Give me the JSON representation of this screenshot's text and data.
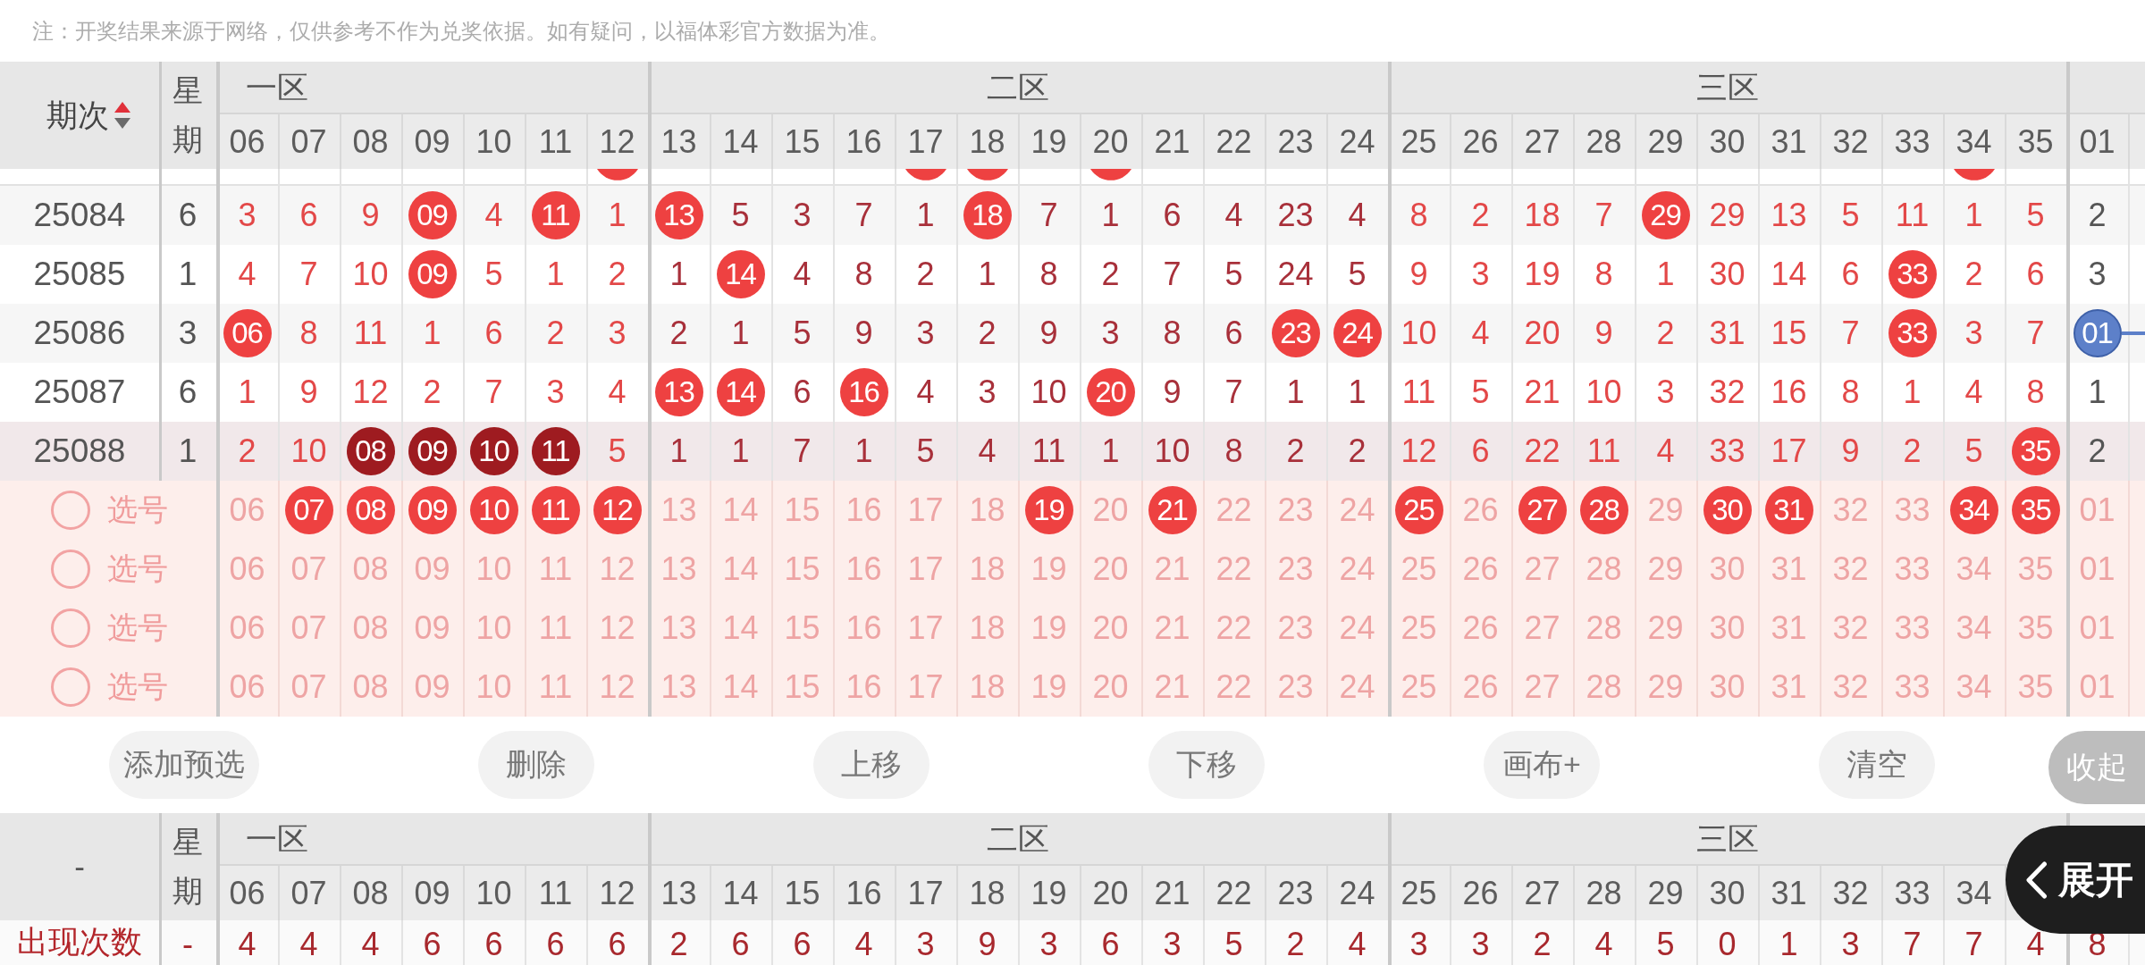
{
  "notice": "注：开奖结果来源于网络，仅供参考不作为兑奖依据。如有疑问，以福体彩官方数据为准。",
  "table": {
    "period_header": {
      "label": "期次",
      "sorted_ascending": true
    },
    "weekday_header": "星期",
    "zones": [
      {
        "name": "一区",
        "color": "#e34848",
        "numbers": [
          "06",
          "07",
          "08",
          "09",
          "10",
          "11",
          "12"
        ]
      },
      {
        "name": "二区",
        "color": "#a8303a",
        "numbers": [
          "13",
          "14",
          "15",
          "16",
          "17",
          "18",
          "19",
          "20",
          "21",
          "22",
          "23",
          "24"
        ]
      },
      {
        "name": "三区",
        "color": "#e34848",
        "numbers": [
          "25",
          "26",
          "27",
          "28",
          "29",
          "30",
          "31",
          "32",
          "33",
          "34",
          "35"
        ]
      },
      {
        "color": "#555555",
        "numbers": [
          "01"
        ]
      }
    ],
    "cut_row": {
      "cells": [
        {
          "hit": false
        },
        {
          "hit": false
        },
        {
          "hit": false
        },
        {
          "hit": false
        },
        {
          "hit": false
        },
        {
          "hit": false
        },
        {
          "hit": true
        },
        {
          "hit": false
        },
        {
          "hit": false
        },
        {
          "hit": false
        },
        {
          "hit": false
        },
        {
          "hit": true
        },
        {
          "hit": true
        },
        {
          "hit": false
        },
        {
          "hit": true
        },
        {
          "hit": false
        },
        {
          "hit": false
        },
        {
          "hit": false
        },
        {
          "hit": false
        },
        {
          "hit": false
        },
        {
          "hit": false
        },
        {
          "hit": false
        },
        {
          "hit": false
        },
        {
          "hit": false
        },
        {
          "hit": false
        },
        {
          "hit": false
        },
        {
          "hit": false
        },
        {
          "hit": false
        },
        {
          "hit": true
        },
        {
          "hit": false
        },
        {
          "hit": false
        }
      ]
    },
    "rows": [
      {
        "period": "25084",
        "weekday": "6",
        "highlighted": false,
        "cells": [
          {
            "value": "3",
            "kind": "plain"
          },
          {
            "value": "6",
            "kind": "plain"
          },
          {
            "value": "9",
            "kind": "plain"
          },
          {
            "value": "09",
            "kind": "hit"
          },
          {
            "value": "4",
            "kind": "plain"
          },
          {
            "value": "11",
            "kind": "hit"
          },
          {
            "value": "1",
            "kind": "plain"
          },
          {
            "value": "13",
            "kind": "hit"
          },
          {
            "value": "5",
            "kind": "plain"
          },
          {
            "value": "3",
            "kind": "plain"
          },
          {
            "value": "7",
            "kind": "plain"
          },
          {
            "value": "1",
            "kind": "plain"
          },
          {
            "value": "18",
            "kind": "hit"
          },
          {
            "value": "7",
            "kind": "plain"
          },
          {
            "value": "1",
            "kind": "plain"
          },
          {
            "value": "6",
            "kind": "plain"
          },
          {
            "value": "4",
            "kind": "plain"
          },
          {
            "value": "23",
            "kind": "plain"
          },
          {
            "value": "4",
            "kind": "plain"
          },
          {
            "value": "8",
            "kind": "plain"
          },
          {
            "value": "2",
            "kind": "plain"
          },
          {
            "value": "18",
            "kind": "plain"
          },
          {
            "value": "7",
            "kind": "plain"
          },
          {
            "value": "29",
            "kind": "hit"
          },
          {
            "value": "29",
            "kind": "plain"
          },
          {
            "value": "13",
            "kind": "plain"
          },
          {
            "value": "5",
            "kind": "plain"
          },
          {
            "value": "11",
            "kind": "plain"
          },
          {
            "value": "1",
            "kind": "plain"
          },
          {
            "value": "5",
            "kind": "plain"
          },
          {
            "value": "2",
            "kind": "plain"
          }
        ]
      },
      {
        "period": "25085",
        "weekday": "1",
        "highlighted": false,
        "cells": [
          {
            "value": "4",
            "kind": "plain"
          },
          {
            "value": "7",
            "kind": "plain"
          },
          {
            "value": "10",
            "kind": "plain"
          },
          {
            "value": "09",
            "kind": "hit"
          },
          {
            "value": "5",
            "kind": "plain"
          },
          {
            "value": "1",
            "kind": "plain"
          },
          {
            "value": "2",
            "kind": "plain"
          },
          {
            "value": "1",
            "kind": "plain"
          },
          {
            "value": "14",
            "kind": "hit"
          },
          {
            "value": "4",
            "kind": "plain"
          },
          {
            "value": "8",
            "kind": "plain"
          },
          {
            "value": "2",
            "kind": "plain"
          },
          {
            "value": "1",
            "kind": "plain"
          },
          {
            "value": "8",
            "kind": "plain"
          },
          {
            "value": "2",
            "kind": "plain"
          },
          {
            "value": "7",
            "kind": "plain"
          },
          {
            "value": "5",
            "kind": "plain"
          },
          {
            "value": "24",
            "kind": "plain"
          },
          {
            "value": "5",
            "kind": "plain"
          },
          {
            "value": "9",
            "kind": "plain"
          },
          {
            "value": "3",
            "kind": "plain"
          },
          {
            "value": "19",
            "kind": "plain"
          },
          {
            "value": "8",
            "kind": "plain"
          },
          {
            "value": "1",
            "kind": "plain"
          },
          {
            "value": "30",
            "kind": "plain"
          },
          {
            "value": "14",
            "kind": "plain"
          },
          {
            "value": "6",
            "kind": "plain"
          },
          {
            "value": "33",
            "kind": "hit"
          },
          {
            "value": "2",
            "kind": "plain"
          },
          {
            "value": "6",
            "kind": "plain"
          },
          {
            "value": "3",
            "kind": "plain"
          }
        ]
      },
      {
        "period": "25086",
        "weekday": "3",
        "highlighted": false,
        "cells": [
          {
            "value": "06",
            "kind": "hit"
          },
          {
            "value": "8",
            "kind": "plain"
          },
          {
            "value": "11",
            "kind": "plain"
          },
          {
            "value": "1",
            "kind": "plain"
          },
          {
            "value": "6",
            "kind": "plain"
          },
          {
            "value": "2",
            "kind": "plain"
          },
          {
            "value": "3",
            "kind": "plain"
          },
          {
            "value": "2",
            "kind": "plain"
          },
          {
            "value": "1",
            "kind": "plain"
          },
          {
            "value": "5",
            "kind": "plain"
          },
          {
            "value": "9",
            "kind": "plain"
          },
          {
            "value": "3",
            "kind": "plain"
          },
          {
            "value": "2",
            "kind": "plain"
          },
          {
            "value": "9",
            "kind": "plain"
          },
          {
            "value": "3",
            "kind": "plain"
          },
          {
            "value": "8",
            "kind": "plain"
          },
          {
            "value": "6",
            "kind": "plain"
          },
          {
            "value": "23",
            "kind": "hit"
          },
          {
            "value": "24",
            "kind": "hit"
          },
          {
            "value": "10",
            "kind": "plain"
          },
          {
            "value": "4",
            "kind": "plain"
          },
          {
            "value": "20",
            "kind": "plain"
          },
          {
            "value": "9",
            "kind": "plain"
          },
          {
            "value": "2",
            "kind": "plain"
          },
          {
            "value": "31",
            "kind": "plain"
          },
          {
            "value": "15",
            "kind": "plain"
          },
          {
            "value": "7",
            "kind": "plain"
          },
          {
            "value": "33",
            "kind": "hit"
          },
          {
            "value": "3",
            "kind": "plain"
          },
          {
            "value": "7",
            "kind": "plain"
          },
          {
            "value": "01",
            "kind": "special"
          }
        ]
      },
      {
        "period": "25087",
        "weekday": "6",
        "highlighted": false,
        "cells": [
          {
            "value": "1",
            "kind": "plain"
          },
          {
            "value": "9",
            "kind": "plain"
          },
          {
            "value": "12",
            "kind": "plain"
          },
          {
            "value": "2",
            "kind": "plain"
          },
          {
            "value": "7",
            "kind": "plain"
          },
          {
            "value": "3",
            "kind": "plain"
          },
          {
            "value": "4",
            "kind": "plain"
          },
          {
            "value": "13",
            "kind": "hit"
          },
          {
            "value": "14",
            "kind": "hit"
          },
          {
            "value": "6",
            "kind": "plain"
          },
          {
            "value": "16",
            "kind": "hit"
          },
          {
            "value": "4",
            "kind": "plain"
          },
          {
            "value": "3",
            "kind": "plain"
          },
          {
            "value": "10",
            "kind": "plain"
          },
          {
            "value": "20",
            "kind": "hit"
          },
          {
            "value": "9",
            "kind": "plain"
          },
          {
            "value": "7",
            "kind": "plain"
          },
          {
            "value": "1",
            "kind": "plain"
          },
          {
            "value": "1",
            "kind": "plain"
          },
          {
            "value": "11",
            "kind": "plain"
          },
          {
            "value": "5",
            "kind": "plain"
          },
          {
            "value": "21",
            "kind": "plain"
          },
          {
            "value": "10",
            "kind": "plain"
          },
          {
            "value": "3",
            "kind": "plain"
          },
          {
            "value": "32",
            "kind": "plain"
          },
          {
            "value": "16",
            "kind": "plain"
          },
          {
            "value": "8",
            "kind": "plain"
          },
          {
            "value": "1",
            "kind": "plain"
          },
          {
            "value": "4",
            "kind": "plain"
          },
          {
            "value": "8",
            "kind": "plain"
          },
          {
            "value": "1",
            "kind": "plain"
          }
        ]
      },
      {
        "period": "25088",
        "weekday": "1",
        "highlighted": true,
        "cells": [
          {
            "value": "2",
            "kind": "plain"
          },
          {
            "value": "10",
            "kind": "plain"
          },
          {
            "value": "08",
            "kind": "consecutive"
          },
          {
            "value": "09",
            "kind": "consecutive"
          },
          {
            "value": "10",
            "kind": "consecutive"
          },
          {
            "value": "11",
            "kind": "consecutive"
          },
          {
            "value": "5",
            "kind": "plain"
          },
          {
            "value": "1",
            "kind": "plain"
          },
          {
            "value": "1",
            "kind": "plain"
          },
          {
            "value": "7",
            "kind": "plain"
          },
          {
            "value": "1",
            "kind": "plain"
          },
          {
            "value": "5",
            "kind": "plain"
          },
          {
            "value": "4",
            "kind": "plain"
          },
          {
            "value": "11",
            "kind": "plain"
          },
          {
            "value": "1",
            "kind": "plain"
          },
          {
            "value": "10",
            "kind": "plain"
          },
          {
            "value": "8",
            "kind": "plain"
          },
          {
            "value": "2",
            "kind": "plain"
          },
          {
            "value": "2",
            "kind": "plain"
          },
          {
            "value": "12",
            "kind": "plain"
          },
          {
            "value": "6",
            "kind": "plain"
          },
          {
            "value": "22",
            "kind": "plain"
          },
          {
            "value": "11",
            "kind": "plain"
          },
          {
            "value": "4",
            "kind": "plain"
          },
          {
            "value": "33",
            "kind": "plain"
          },
          {
            "value": "17",
            "kind": "plain"
          },
          {
            "value": "9",
            "kind": "plain"
          },
          {
            "value": "2",
            "kind": "plain"
          },
          {
            "value": "5",
            "kind": "plain"
          },
          {
            "value": "35",
            "kind": "hit"
          },
          {
            "value": "2",
            "kind": "plain"
          }
        ]
      }
    ]
  },
  "pick_rows": [
    {
      "label": "选号",
      "checked": false,
      "numbers": [
        {
          "number": "06",
          "selected": false
        },
        {
          "number": "07",
          "selected": true
        },
        {
          "number": "08",
          "selected": true
        },
        {
          "number": "09",
          "selected": true
        },
        {
          "number": "10",
          "selected": true
        },
        {
          "number": "11",
          "selected": true
        },
        {
          "number": "12",
          "selected": true
        },
        {
          "number": "13",
          "selected": false
        },
        {
          "number": "14",
          "selected": false
        },
        {
          "number": "15",
          "selected": false
        },
        {
          "number": "16",
          "selected": false
        },
        {
          "number": "17",
          "selected": false
        },
        {
          "number": "18",
          "selected": false
        },
        {
          "number": "19",
          "selected": true
        },
        {
          "number": "20",
          "selected": false
        },
        {
          "number": "21",
          "selected": true
        },
        {
          "number": "22",
          "selected": false
        },
        {
          "number": "23",
          "selected": false
        },
        {
          "number": "24",
          "selected": false
        },
        {
          "number": "25",
          "selected": true
        },
        {
          "number": "26",
          "selected": false
        },
        {
          "number": "27",
          "selected": true
        },
        {
          "number": "28",
          "selected": true
        },
        {
          "number": "29",
          "selected": false
        },
        {
          "number": "30",
          "selected": true
        },
        {
          "number": "31",
          "selected": true
        },
        {
          "number": "32",
          "selected": false
        },
        {
          "number": "33",
          "selected": false
        },
        {
          "number": "34",
          "selected": true
        },
        {
          "number": "35",
          "selected": true
        },
        {
          "number": "01",
          "selected": false
        }
      ]
    },
    {
      "label": "选号",
      "checked": false,
      "numbers": [
        {
          "number": "06",
          "selected": false
        },
        {
          "number": "07",
          "selected": false
        },
        {
          "number": "08",
          "selected": false
        },
        {
          "number": "09",
          "selected": false
        },
        {
          "number": "10",
          "selected": false
        },
        {
          "number": "11",
          "selected": false
        },
        {
          "number": "12",
          "selected": false
        },
        {
          "number": "13",
          "selected": false
        },
        {
          "number": "14",
          "selected": false
        },
        {
          "number": "15",
          "selected": false
        },
        {
          "number": "16",
          "selected": false
        },
        {
          "number": "17",
          "selected": false
        },
        {
          "number": "18",
          "selected": false
        },
        {
          "number": "19",
          "selected": false
        },
        {
          "number": "20",
          "selected": false
        },
        {
          "number": "21",
          "selected": false
        },
        {
          "number": "22",
          "selected": false
        },
        {
          "number": "23",
          "selected": false
        },
        {
          "number": "24",
          "selected": false
        },
        {
          "number": "25",
          "selected": false
        },
        {
          "number": "26",
          "selected": false
        },
        {
          "number": "27",
          "selected": false
        },
        {
          "number": "28",
          "selected": false
        },
        {
          "number": "29",
          "selected": false
        },
        {
          "number": "30",
          "selected": false
        },
        {
          "number": "31",
          "selected": false
        },
        {
          "number": "32",
          "selected": false
        },
        {
          "number": "33",
          "selected": false
        },
        {
          "number": "34",
          "selected": false
        },
        {
          "number": "35",
          "selected": false
        },
        {
          "number": "01",
          "selected": false
        }
      ]
    },
    {
      "label": "选号",
      "checked": false,
      "numbers": [
        {
          "number": "06",
          "selected": false
        },
        {
          "number": "07",
          "selected": false
        },
        {
          "number": "08",
          "selected": false
        },
        {
          "number": "09",
          "selected": false
        },
        {
          "number": "10",
          "selected": false
        },
        {
          "number": "11",
          "selected": false
        },
        {
          "number": "12",
          "selected": false
        },
        {
          "number": "13",
          "selected": false
        },
        {
          "number": "14",
          "selected": false
        },
        {
          "number": "15",
          "selected": false
        },
        {
          "number": "16",
          "selected": false
        },
        {
          "number": "17",
          "selected": false
        },
        {
          "number": "18",
          "selected": false
        },
        {
          "number": "19",
          "selected": false
        },
        {
          "number": "20",
          "selected": false
        },
        {
          "number": "21",
          "selected": false
        },
        {
          "number": "22",
          "selected": false
        },
        {
          "number": "23",
          "selected": false
        },
        {
          "number": "24",
          "selected": false
        },
        {
          "number": "25",
          "selected": false
        },
        {
          "number": "26",
          "selected": false
        },
        {
          "number": "27",
          "selected": false
        },
        {
          "number": "28",
          "selected": false
        },
        {
          "number": "29",
          "selected": false
        },
        {
          "number": "30",
          "selected": false
        },
        {
          "number": "31",
          "selected": false
        },
        {
          "number": "32",
          "selected": false
        },
        {
          "number": "33",
          "selected": false
        },
        {
          "number": "34",
          "selected": false
        },
        {
          "number": "35",
          "selected": false
        },
        {
          "number": "01",
          "selected": false
        }
      ]
    },
    {
      "label": "选号",
      "checked": false,
      "numbers": [
        {
          "number": "06",
          "selected": false
        },
        {
          "number": "07",
          "selected": false
        },
        {
          "number": "08",
          "selected": false
        },
        {
          "number": "09",
          "selected": false
        },
        {
          "number": "10",
          "selected": false
        },
        {
          "number": "11",
          "selected": false
        },
        {
          "number": "12",
          "selected": false
        },
        {
          "number": "13",
          "selected": false
        },
        {
          "number": "14",
          "selected": false
        },
        {
          "number": "15",
          "selected": false
        },
        {
          "number": "16",
          "selected": false
        },
        {
          "number": "17",
          "selected": false
        },
        {
          "number": "18",
          "selected": false
        },
        {
          "number": "19",
          "selected": false
        },
        {
          "number": "20",
          "selected": false
        },
        {
          "number": "21",
          "selected": false
        },
        {
          "number": "22",
          "selected": false
        },
        {
          "number": "23",
          "selected": false
        },
        {
          "number": "24",
          "selected": false
        },
        {
          "number": "25",
          "selected": false
        },
        {
          "number": "26",
          "selected": false
        },
        {
          "number": "27",
          "selected": false
        },
        {
          "number": "28",
          "selected": false
        },
        {
          "number": "29",
          "selected": false
        },
        {
          "number": "30",
          "selected": false
        },
        {
          "number": "31",
          "selected": false
        },
        {
          "number": "32",
          "selected": false
        },
        {
          "number": "33",
          "selected": false
        },
        {
          "number": "34",
          "selected": false
        },
        {
          "number": "35",
          "selected": false
        },
        {
          "number": "01",
          "selected": false
        }
      ]
    }
  ],
  "actions": [
    "添加预选",
    "删除",
    "上移",
    "下移",
    "画布+",
    "清空"
  ],
  "collapse_button": "收起",
  "summary_table": {
    "period_header": "-",
    "weekday_header": "星期",
    "zones": [
      {
        "name": "一区",
        "numbers": [
          "06",
          "07",
          "08",
          "09",
          "10",
          "11",
          "12"
        ]
      },
      {
        "name": "二区",
        "numbers": [
          "13",
          "14",
          "15",
          "16",
          "17",
          "18",
          "19",
          "20",
          "21",
          "22",
          "23",
          "24"
        ]
      },
      {
        "name": "三区",
        "numbers": [
          "25",
          "26",
          "27",
          "28",
          "29",
          "30",
          "31",
          "32",
          "33",
          "34"
        ]
      }
    ],
    "rows": [
      {
        "label": "出现次数",
        "weekday": "-",
        "values": [
          "4",
          "4",
          "4",
          "6",
          "6",
          "6",
          "6",
          "2",
          "6",
          "6",
          "4",
          "3",
          "9",
          "3",
          "6",
          "3",
          "5",
          "2",
          "4",
          "3",
          "3",
          "2",
          "4",
          "5",
          "0",
          "1",
          "3",
          "7",
          "7",
          "4",
          "8"
        ]
      }
    ]
  },
  "expand_button": "展开"
}
